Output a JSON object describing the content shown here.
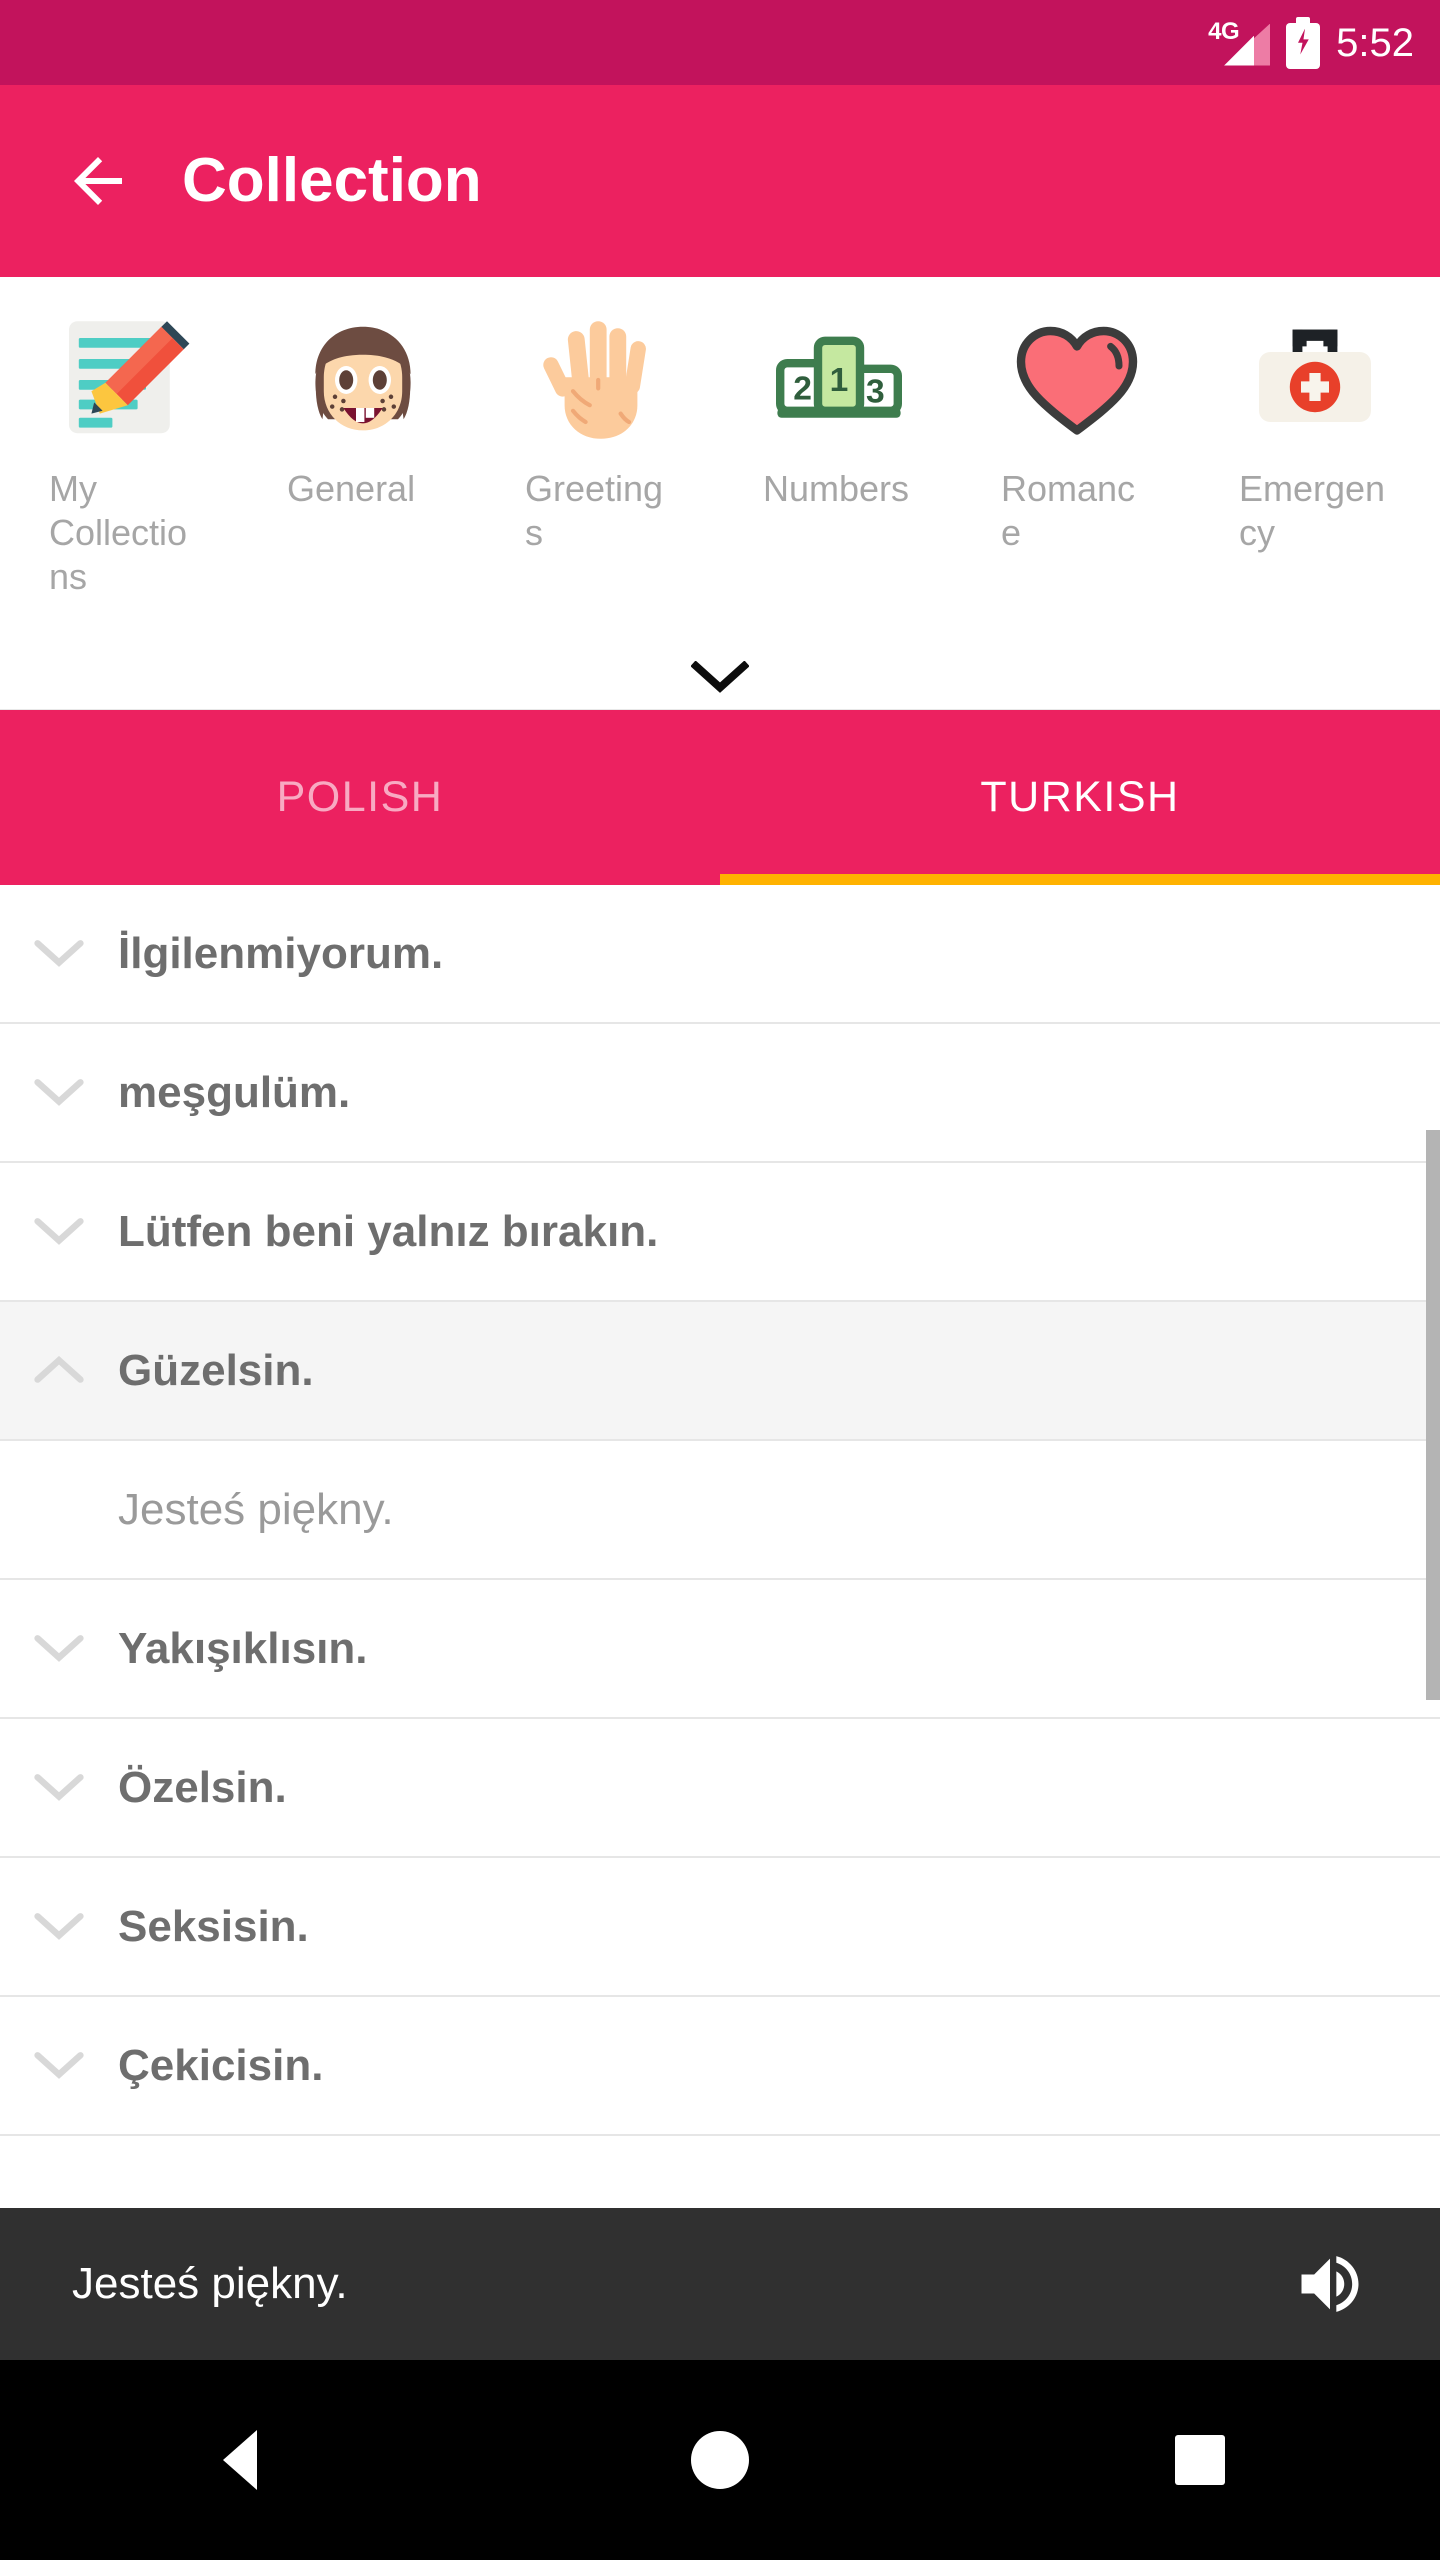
{
  "status_bar": {
    "network_label": "4G",
    "time": "5:52",
    "battery_icon": "battery-charging-icon",
    "signal_icon": "signal-bars-icon"
  },
  "app_bar": {
    "back_icon": "arrow-back-icon",
    "title": "Collection",
    "background_color": "#EC2160"
  },
  "categories": {
    "expand_icon": "chevron-down-icon",
    "items": [
      {
        "label": "My Collections",
        "icon": "note-pencil-icon"
      },
      {
        "label": "General",
        "icon": "girl-face-icon"
      },
      {
        "label": "Greetings",
        "icon": "open-hand-icon"
      },
      {
        "label": "Numbers",
        "icon": "podium-123-icon"
      },
      {
        "label": "Romance",
        "icon": "heart-icon"
      },
      {
        "label": "Emergency",
        "icon": "first-aid-kit-icon"
      }
    ]
  },
  "tabs": {
    "items": [
      {
        "label": "POLISH",
        "active": false
      },
      {
        "label": "TURKISH",
        "active": true
      }
    ],
    "indicator_color": "#FFB200"
  },
  "phrase_list": {
    "collapsed_icon": "chevron-down-icon",
    "expanded_icon": "chevron-up-icon",
    "rows": [
      {
        "text": "İlgilenmiyorum.",
        "expanded": false,
        "kind": "phrase"
      },
      {
        "text": "meşgulüm.",
        "expanded": false,
        "kind": "phrase"
      },
      {
        "text": "Lütfen beni yalnız bırakın.",
        "expanded": false,
        "kind": "phrase"
      },
      {
        "text": "Güzelsin.",
        "expanded": true,
        "kind": "phrase"
      },
      {
        "text": "Jesteś piękny.",
        "expanded": false,
        "kind": "translation"
      },
      {
        "text": "Yakışıklısın.",
        "expanded": false,
        "kind": "phrase"
      },
      {
        "text": "Özelsin.",
        "expanded": false,
        "kind": "phrase"
      },
      {
        "text": "Seksisin.",
        "expanded": false,
        "kind": "phrase"
      },
      {
        "text": "Çekicisin.",
        "expanded": false,
        "kind": "phrase"
      }
    ]
  },
  "player_bar": {
    "text": "Jesteś piękny.",
    "speaker_icon": "volume-up-icon",
    "background_color": "#303030"
  },
  "nav_bar": {
    "back_icon": "nav-back-triangle-icon",
    "home_icon": "nav-home-circle-icon",
    "recents_icon": "nav-recents-square-icon"
  }
}
